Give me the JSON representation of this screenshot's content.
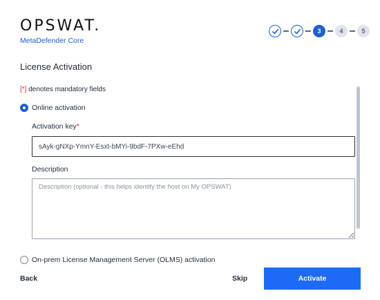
{
  "header": {
    "logo_text": "OPSWAT.",
    "product_name": "MetaDefender Core"
  },
  "stepper": {
    "steps": [
      {
        "label": "",
        "state": "done",
        "icon": "check-icon"
      },
      {
        "label": "",
        "state": "done",
        "icon": "check-icon"
      },
      {
        "label": "3",
        "state": "current"
      },
      {
        "label": "4",
        "state": "todo"
      },
      {
        "label": "5",
        "state": "todo"
      }
    ]
  },
  "page": {
    "title": "License Activation",
    "mandatory_bracket": "[*]",
    "mandatory_text": " denotes mandatory fields"
  },
  "online": {
    "label": "Online activation",
    "selected": true,
    "key_label": "Activation key",
    "key_required_marker": "*",
    "key_value": "sAyk-gNXp-YmnY-Esxt-bMYi-9bdF-7PXw-eEhd",
    "desc_label": "Description",
    "desc_placeholder": "Description (optional - this helps identify the host on My OPSWAT)",
    "desc_value": ""
  },
  "olms": {
    "label": "On-prem License Management Server (OLMS) activation",
    "selected": false
  },
  "footer": {
    "back_label": "Back",
    "skip_label": "Skip",
    "activate_label": "Activate"
  },
  "colors": {
    "accent": "#1d5fd6",
    "primary_button": "#1d6bf5",
    "required": "#d12d2d"
  }
}
